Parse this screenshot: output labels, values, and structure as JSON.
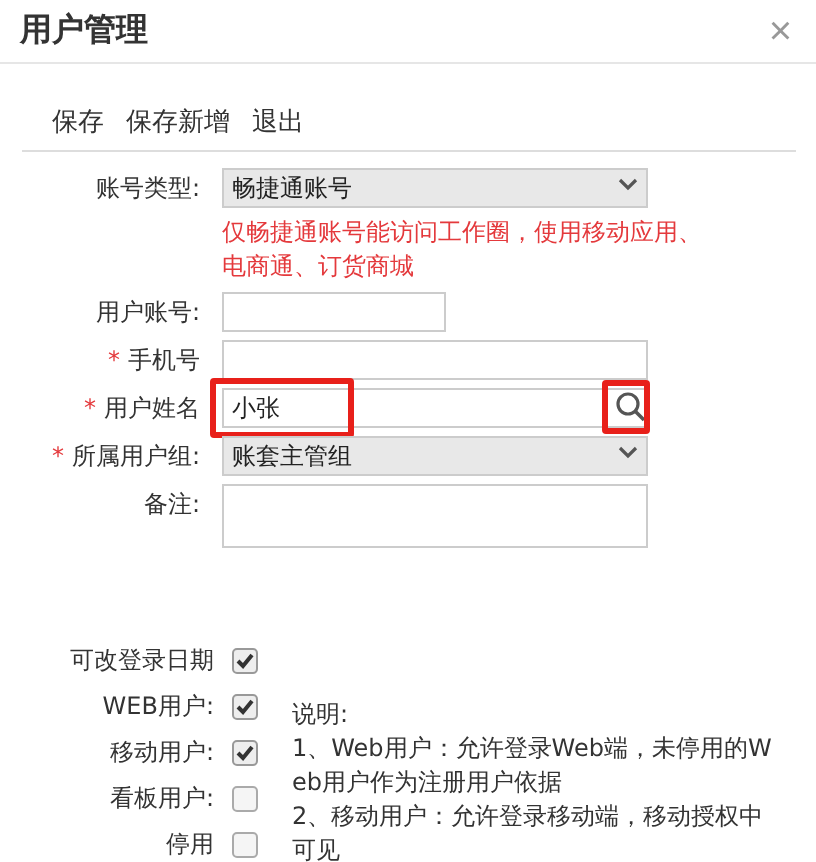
{
  "window": {
    "title": "用户管理",
    "close": "×"
  },
  "toolbar": [
    "保存",
    "保存新增",
    "退出"
  ],
  "form": [
    {
      "kind": "select",
      "label": "账号类型:",
      "value": "畅捷通账号",
      "hint": [
        "仅畅捷通账号能访问工作圈，使用移动应用、",
        "电商通、订货商城"
      ],
      "highlighted": false
    },
    {
      "kind": "short",
      "label": "用户账号:",
      "highlighted": false
    },
    {
      "kind": "text",
      "required_mark": "*",
      "label": "手机号",
      "highlighted": false
    },
    {
      "kind": "lookup",
      "required_mark": "*",
      "label": "用户姓名",
      "value": "小张",
      "highlighted": true
    },
    {
      "kind": "select",
      "required_mark": "*",
      "label": "所属用户组:",
      "value": "账套主管组",
      "highlighted": false
    },
    {
      "kind": "textarea",
      "label": "备注:",
      "highlighted": false
    }
  ],
  "options": [
    {
      "label": "可改登录日期",
      "checked": true
    },
    {
      "label": "WEB用户:",
      "checked": true
    },
    {
      "label": "移动用户:",
      "checked": true
    },
    {
      "label": "看板用户:",
      "checked": false
    },
    {
      "label": "停用",
      "checked": false
    }
  ],
  "notes": {
    "title": "说明:",
    "lines": [
      "1、Web用户：允许登录Web端，未停用的W",
      "eb用户作为注册用户依据",
      "2、移动用户：允许登录移动端，移动授权中",
      "可见"
    ]
  }
}
